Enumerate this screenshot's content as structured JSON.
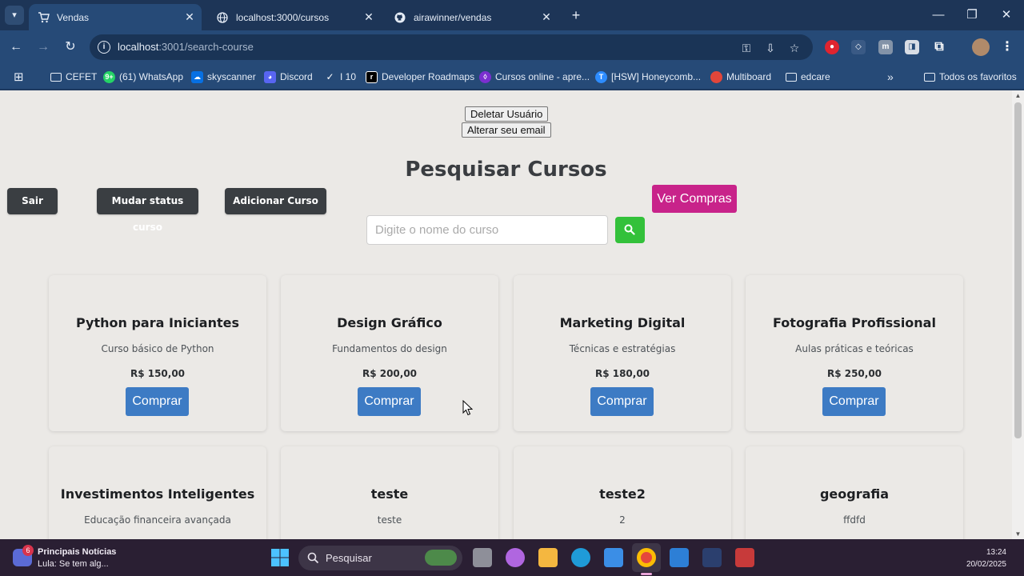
{
  "browser": {
    "tabs": [
      {
        "title": "Vendas",
        "active": true
      },
      {
        "title": "localhost:3000/cursos",
        "active": false
      },
      {
        "title": "airawinner/vendas",
        "active": false
      }
    ],
    "url_host": "localhost",
    "url_rest": ":3001/search-course",
    "bookmarks": [
      {
        "label": "CEFET",
        "icon": "folder-icon"
      },
      {
        "label": "(61) WhatsApp",
        "icon": "whatsapp-icon"
      },
      {
        "label": "skyscanner",
        "icon": "skyscanner-icon"
      },
      {
        "label": "Discord",
        "icon": "discord-icon"
      },
      {
        "label": "I 10",
        "icon": "check-icon"
      },
      {
        "label": "Developer Roadmaps",
        "icon": "roadmap-icon"
      },
      {
        "label": "Cursos online - apre...",
        "icon": "courses-icon"
      },
      {
        "label": "[HSW] Honeycomb...",
        "icon": "hsw-icon"
      },
      {
        "label": "Multiboard",
        "icon": "multiboard-icon"
      },
      {
        "label": "edcare",
        "icon": "folder-icon"
      }
    ],
    "all_bookmarks": "Todos os favoritos",
    "whatsapp_badge": "9+"
  },
  "page": {
    "delete_user": "Deletar Usuário",
    "change_email": "Alterar seu email",
    "title": "Pesquisar Cursos",
    "btn_logout": "Sair",
    "btn_change_status": "Mudar status curso",
    "btn_add_course": "Adicionar Curso",
    "btn_view_purchases": "Ver Compras",
    "search_placeholder": "Digite o nome do curso",
    "courses": [
      {
        "title": "Python para Iniciantes",
        "desc": "Curso básico de Python",
        "price": "R$ 150,00",
        "buy": "Comprar"
      },
      {
        "title": "Design Gráfico",
        "desc": "Fundamentos do design",
        "price": "R$ 200,00",
        "buy": "Comprar"
      },
      {
        "title": "Marketing Digital",
        "desc": "Técnicas e estratégias",
        "price": "R$ 180,00",
        "buy": "Comprar"
      },
      {
        "title": "Fotografia Profissional",
        "desc": "Aulas práticas e teóricas",
        "price": "R$ 250,00",
        "buy": "Comprar"
      },
      {
        "title": "Investimentos Inteligentes",
        "desc": "Educação financeira avançada"
      },
      {
        "title": "teste",
        "desc": "teste"
      },
      {
        "title": "teste2",
        "desc": "2"
      },
      {
        "title": "geografia",
        "desc": "ffdfd"
      }
    ]
  },
  "taskbar": {
    "news_badge": "6",
    "news_title": "Principais Notícias",
    "news_text": "Lula: Se tem alg...",
    "search_label": "Pesquisar",
    "time": "13:24",
    "date": "20/02/2025"
  },
  "colors": {
    "accent_pink": "#c8238a",
    "buy_blue": "#3d7bc4",
    "search_green": "#33c13a",
    "dark_button": "#3a3e42"
  }
}
